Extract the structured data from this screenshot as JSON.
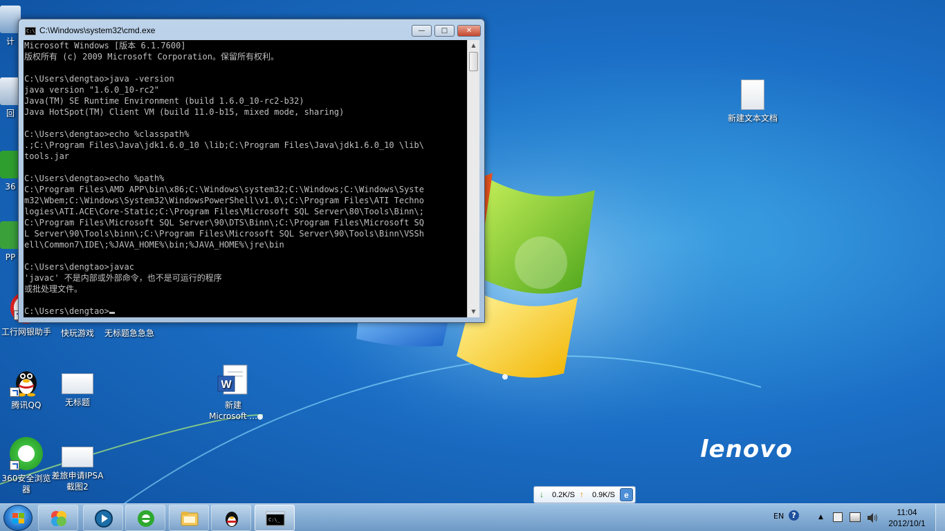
{
  "window": {
    "title": "C:\\Windows\\system32\\cmd.exe",
    "controls": {
      "minimize": "—",
      "maximize": "□",
      "close": "✕"
    }
  },
  "console": {
    "lines": [
      "Microsoft Windows [版本 6.1.7600]",
      "版权所有 (c) 2009 Microsoft Corporation。保留所有权利。",
      "",
      "C:\\Users\\dengtao>java -version",
      "java version \"1.6.0_10-rc2\"",
      "Java(TM) SE Runtime Environment (build 1.6.0_10-rc2-b32)",
      "Java HotSpot(TM) Client VM (build 11.0-b15, mixed mode, sharing)",
      "",
      "C:\\Users\\dengtao>echo %classpath%",
      ".;C:\\Program Files\\Java\\jdk1.6.0_10 \\lib;C:\\Program Files\\Java\\jdk1.6.0_10 \\lib\\",
      "tools.jar",
      "",
      "C:\\Users\\dengtao>echo %path%",
      "C:\\Program Files\\AMD APP\\bin\\x86;C:\\Windows\\system32;C:\\Windows;C:\\Windows\\Syste",
      "m32\\Wbem;C:\\Windows\\System32\\WindowsPowerShell\\v1.0\\;C:\\Program Files\\ATI Techno",
      "logies\\ATI.ACE\\Core-Static;C:\\Program Files\\Microsoft SQL Server\\80\\Tools\\Binn\\;",
      "C:\\Program Files\\Microsoft SQL Server\\90\\DTS\\Binn\\;C:\\Program Files\\Microsoft SQ",
      "L Server\\90\\Tools\\binn\\;C:\\Program Files\\Microsoft SQL Server\\90\\Tools\\Binn\\VSSh",
      "ell\\Common7\\IDE\\;%JAVA_HOME%\\bin;%JAVA_HOME%\\jre\\bin",
      "",
      "C:\\Users\\dengtao>javac",
      "'javac' 不是内部或外部命令，也不是可运行的程序",
      "或批处理文件。",
      "",
      "C:\\Users\\dengtao>"
    ]
  },
  "desktop": {
    "icons": {
      "txt_file": "新建文本文档",
      "icbc": "工行网银助手",
      "kuaiwan": "快玩游戏",
      "untitled_flow": "无标题急急急",
      "qq": "腾讯QQ",
      "untitled": "无标题",
      "word_doc": "新建 Microsoft ...",
      "browser360": "360安全浏览器",
      "travel": "差旅申请IPSA截图2",
      "partial_1": "计",
      "partial_2": "回",
      "partial_3": "36",
      "partial_4": "PP"
    },
    "brand": "lenovo"
  },
  "net_widget": {
    "down": "0.2K/S",
    "up": "0.9K/S",
    "down_arrow": "↓",
    "up_arrow": "↑",
    "icon": "e"
  },
  "taskbar": {
    "apps": [
      "360-safe-icon",
      "qvod-player-icon",
      "360-browser-icon",
      "explorer-folder-icon",
      "qq-penguin-icon",
      "cmd-icon"
    ]
  },
  "tray": {
    "lang": "EN",
    "help": "?",
    "chevron": "▲"
  },
  "clock": {
    "time": "11:04",
    "date": "2012/10/1"
  },
  "colors": {
    "desktop": "#1b6fc6",
    "console_bg": "#000000",
    "console_fg": "#c0c0c0"
  }
}
